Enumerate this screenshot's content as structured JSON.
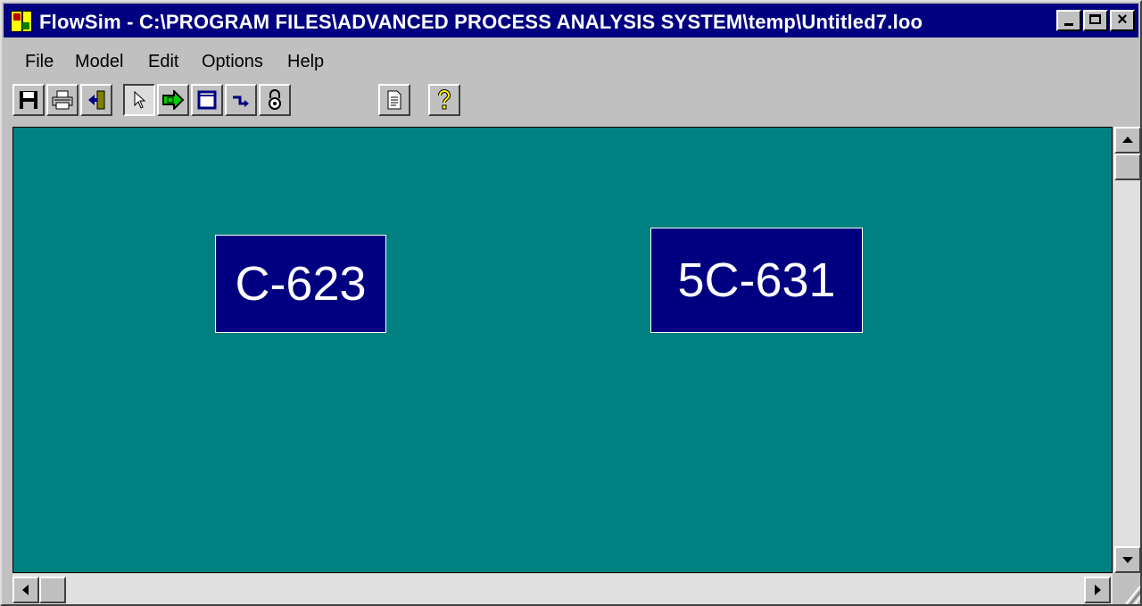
{
  "window": {
    "title": "FlowSim - C:\\PROGRAM FILES\\ADVANCED PROCESS ANALYSIS SYSTEM\\temp\\Untitled7.loo",
    "minimize_label": "",
    "maximize_label": "",
    "close_label": "×"
  },
  "menu": {
    "file": "File",
    "model": "Model",
    "edit": "Edit",
    "options": "Options",
    "help": "Help"
  },
  "toolbar": {
    "icons": [
      "save-icon",
      "print-icon",
      "exit-icon",
      "pointer-icon",
      "process-unit-icon",
      "box-icon",
      "connector-icon",
      "lock-icon",
      "document-icon",
      "help-icon"
    ]
  },
  "canvas": {
    "background": "#008080",
    "nodes": [
      {
        "label": "C-623"
      },
      {
        "label": "5C-631"
      }
    ]
  }
}
